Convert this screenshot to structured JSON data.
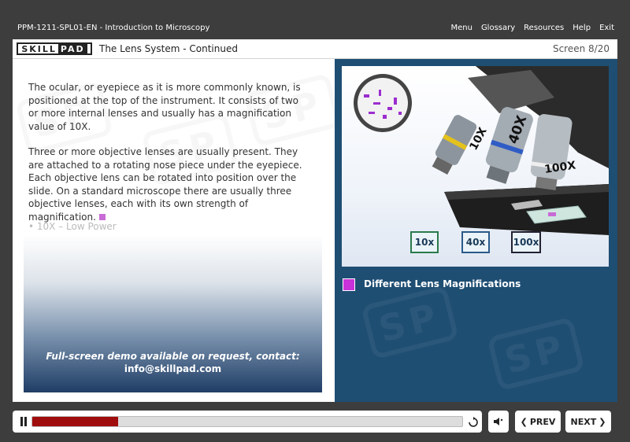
{
  "top_bar": {
    "course_title": "PPM-1211-SPL01-EN - Introduction to Microscopy",
    "menu": [
      "Menu",
      "Glossary",
      "Resources",
      "Help",
      "Exit"
    ]
  },
  "header": {
    "logo_skill": "SKILL",
    "logo_pad": "PAD",
    "title": "The Lens System - Continued",
    "screen_count": "Screen 8/20"
  },
  "content": {
    "paragraphs": [
      "The ocular, or eyepiece as it is more commonly known, is positioned at the top of the instrument. It consists of two or more internal lenses and usually has a magnification value of 10X.",
      "Three or more objective lenses are usually present. They are attached to a rotating nose piece under the eyepiece. Each objective lens can be rotated into position over the slide. On a standard microscope there are usually three objective lenses, each with its own strength of magnification."
    ],
    "bullet": "• 10X – Low Power",
    "demo_line1": "Full-screen demo available on request, contact:",
    "demo_line2": "info@skillpad.com"
  },
  "image": {
    "objective_labels": [
      "10X",
      "40X",
      "100X"
    ],
    "buttons": [
      "10x",
      "40x",
      "100x"
    ],
    "caption": "Different Lens Magnifications",
    "caption_color": "#c832d8"
  },
  "player": {
    "progress": 0.2,
    "prev_label": "PREV",
    "next_label": "NEXT"
  },
  "colors": {
    "progress_fill": "#a00d0d",
    "right_panel": "#1f4e73"
  }
}
